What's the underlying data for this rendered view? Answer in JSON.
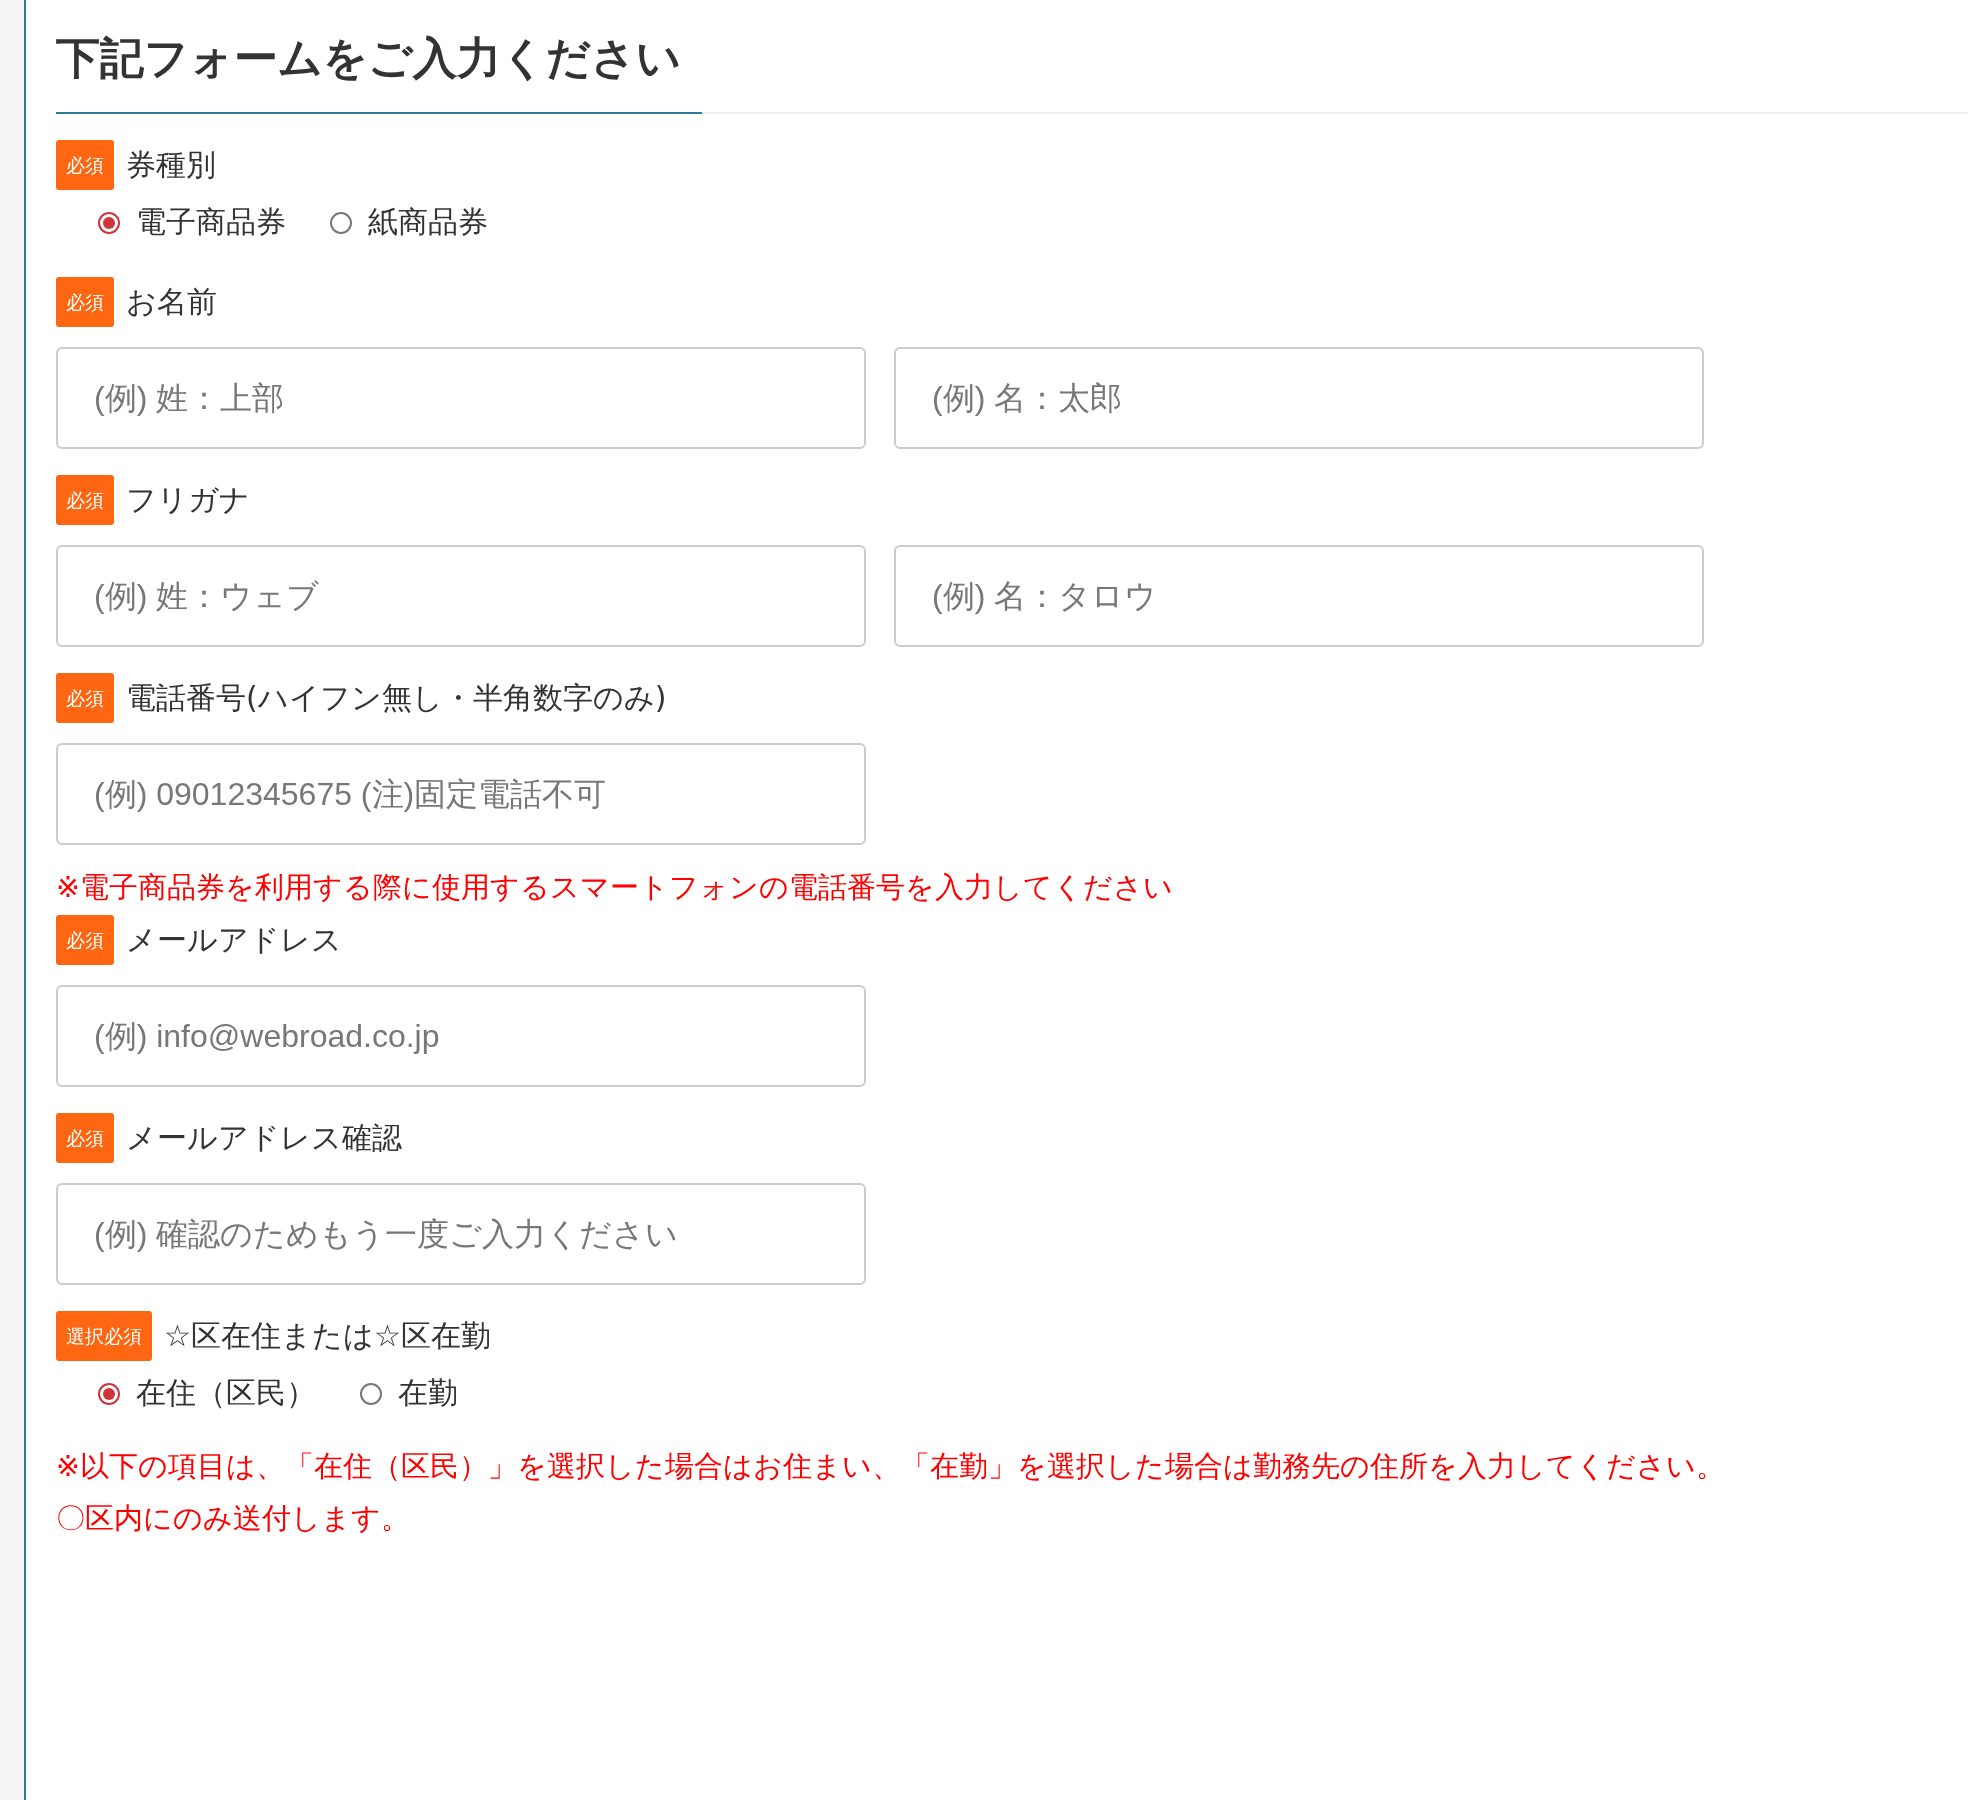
{
  "title": "下記フォームをご入力ください",
  "fields": [
    {
      "kind": "radio",
      "badge": "必須",
      "label": "券種別",
      "options": [
        {
          "label": "電子商品券",
          "selected": true
        },
        {
          "label": "紙商品券",
          "selected": false
        }
      ]
    },
    {
      "kind": "inputs",
      "badge": "必須",
      "label": "お名前",
      "inputs": [
        {
          "placeholder": "(例) 姓：上部"
        },
        {
          "placeholder": "(例) 名：太郎"
        }
      ]
    },
    {
      "kind": "inputs",
      "badge": "必須",
      "label": "フリガナ",
      "inputs": [
        {
          "placeholder": "(例) 姓：ウェブ"
        },
        {
          "placeholder": "(例) 名：タロウ"
        }
      ]
    },
    {
      "kind": "inputs",
      "badge": "必須",
      "label": "電話番号(ハイフン無し・半角数字のみ)",
      "inputs": [
        {
          "placeholder": "(例) 09012345675 (注)固定電話不可"
        }
      ]
    },
    {
      "kind": "note",
      "text": "※電子商品券を利用する際に使用するスマートフォンの電話番号を入力してください"
    },
    {
      "kind": "inputs",
      "badge": "必須",
      "label": "メールアドレス",
      "inputs": [
        {
          "placeholder": "(例) info@webroad.co.jp"
        }
      ]
    },
    {
      "kind": "inputs",
      "badge": "必須",
      "label": "メールアドレス確認",
      "inputs": [
        {
          "placeholder": "(例) 確認のためもう一度ご入力ください"
        }
      ]
    },
    {
      "kind": "radio",
      "badge": "選択必須",
      "label": "☆区在住または☆区在勤",
      "options": [
        {
          "label": "在住（区民）",
          "selected": true
        },
        {
          "label": "在勤",
          "selected": false
        }
      ]
    },
    {
      "kind": "note",
      "text": "※以下の項目は、「在住（区民）」を選択した場合はお住まい、「在勤」を選択した場合は勤務先の住所を入力してください。"
    },
    {
      "kind": "note",
      "text": "〇区内にのみ送付します。"
    }
  ]
}
